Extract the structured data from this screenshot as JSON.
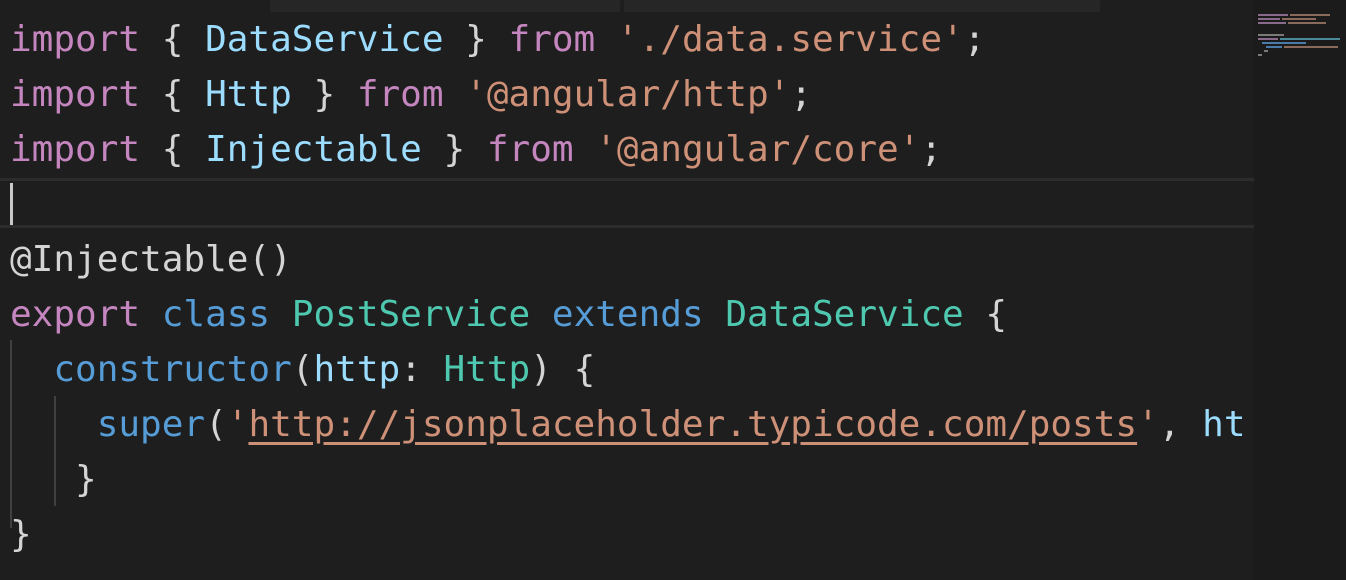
{
  "editor": {
    "lines": [
      {
        "tokens": [
          {
            "t": "import",
            "c": "kw"
          },
          {
            "t": " { ",
            "c": "pun"
          },
          {
            "t": "DataService",
            "c": "id"
          },
          {
            "t": " } ",
            "c": "pun"
          },
          {
            "t": "from",
            "c": "kw"
          },
          {
            "t": " ",
            "c": "pun"
          },
          {
            "t": "'./data.service'",
            "c": "str"
          },
          {
            "t": ";",
            "c": "pun"
          }
        ]
      },
      {
        "tokens": [
          {
            "t": "import",
            "c": "kw"
          },
          {
            "t": " { ",
            "c": "pun"
          },
          {
            "t": "Http",
            "c": "id"
          },
          {
            "t": " } ",
            "c": "pun"
          },
          {
            "t": "from",
            "c": "kw"
          },
          {
            "t": " ",
            "c": "pun"
          },
          {
            "t": "'@angular/http'",
            "c": "str"
          },
          {
            "t": ";",
            "c": "pun"
          }
        ]
      },
      {
        "tokens": [
          {
            "t": "import",
            "c": "kw"
          },
          {
            "t": " { ",
            "c": "pun"
          },
          {
            "t": "Injectable",
            "c": "id"
          },
          {
            "t": " } ",
            "c": "pun"
          },
          {
            "t": "from",
            "c": "kw"
          },
          {
            "t": " ",
            "c": "pun"
          },
          {
            "t": "'@angular/core'",
            "c": "str"
          },
          {
            "t": ";",
            "c": "pun"
          }
        ]
      },
      {
        "tokens": []
      },
      {
        "tokens": [
          {
            "t": "@Injectable()",
            "c": "pun"
          }
        ]
      },
      {
        "tokens": [
          {
            "t": "export",
            "c": "kw"
          },
          {
            "t": " ",
            "c": "pun"
          },
          {
            "t": "class",
            "c": "kwb"
          },
          {
            "t": " ",
            "c": "pun"
          },
          {
            "t": "PostService",
            "c": "ty"
          },
          {
            "t": " ",
            "c": "pun"
          },
          {
            "t": "extends",
            "c": "kwb"
          },
          {
            "t": " ",
            "c": "pun"
          },
          {
            "t": "DataService",
            "c": "ty"
          },
          {
            "t": " {",
            "c": "pun"
          }
        ]
      },
      {
        "tokens": [
          {
            "t": "  ",
            "c": "pun"
          },
          {
            "t": "constructor",
            "c": "kwb"
          },
          {
            "t": "(",
            "c": "pun"
          },
          {
            "t": "http",
            "c": "id"
          },
          {
            "t": ": ",
            "c": "pun"
          },
          {
            "t": "Http",
            "c": "ty"
          },
          {
            "t": ") {",
            "c": "pun"
          }
        ]
      },
      {
        "tokens": [
          {
            "t": "    ",
            "c": "pun"
          },
          {
            "t": "super",
            "c": "kwb"
          },
          {
            "t": "(",
            "c": "pun"
          },
          {
            "t": "'",
            "c": "str"
          },
          {
            "t": "http://jsonplaceholder.typicode.com/posts",
            "c": "url"
          },
          {
            "t": "'",
            "c": "str"
          },
          {
            "t": ", ",
            "c": "pun"
          },
          {
            "t": "ht",
            "c": "id"
          }
        ]
      },
      {
        "tokens": [
          {
            "t": "   }",
            "c": "pun"
          }
        ]
      },
      {
        "tokens": [
          {
            "t": "}",
            "c": "pun"
          }
        ]
      }
    ]
  }
}
